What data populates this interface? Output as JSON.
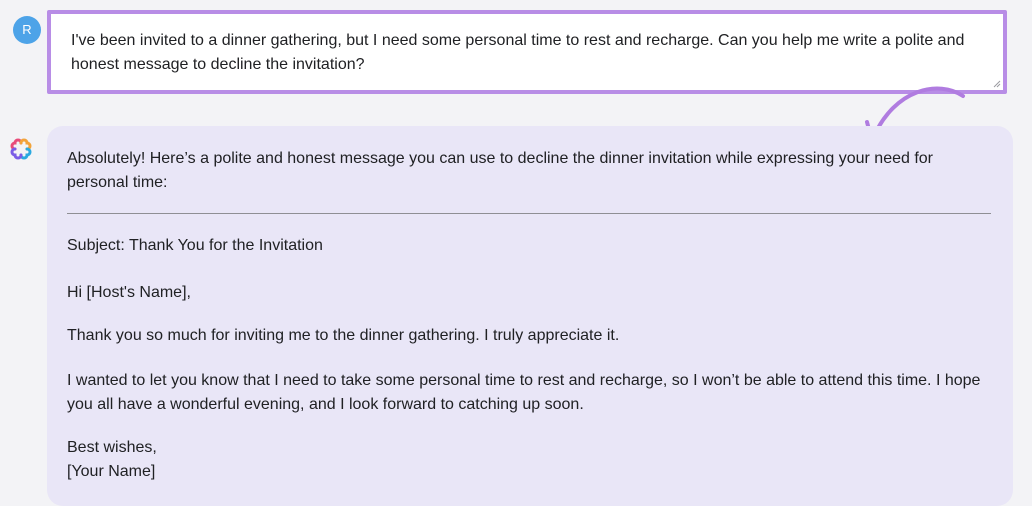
{
  "user": {
    "avatar_initial": "R",
    "prompt": "I've been invited to a dinner gathering, but I need some personal time to rest and recharge. Can you help me write a polite and honest message to decline the invitation?"
  },
  "assistant": {
    "icon": "assistant-logo-icon",
    "intro": "Absolutely! Here’s a polite and honest message you can use to decline the dinner invitation while expressing your need for personal time:",
    "subject": "Subject: Thank You for the Invitation",
    "greeting": "Hi [Host's Name],",
    "body_1": "Thank you so much for inviting me to the dinner gathering. I truly appreciate it.",
    "body_2": "I wanted to let you know that I need to take some personal time to rest and recharge, so I won’t be able to attend this time. I hope you all have a wonderful evening, and I look forward to catching up soon.",
    "signoff": "Best wishes,",
    "signature": "[Your Name]"
  },
  "colors": {
    "prompt_border": "#b88de6",
    "response_background": "#e9e6f7",
    "avatar_background": "#4da3e8",
    "annotation_arrow": "#b07ce0"
  }
}
